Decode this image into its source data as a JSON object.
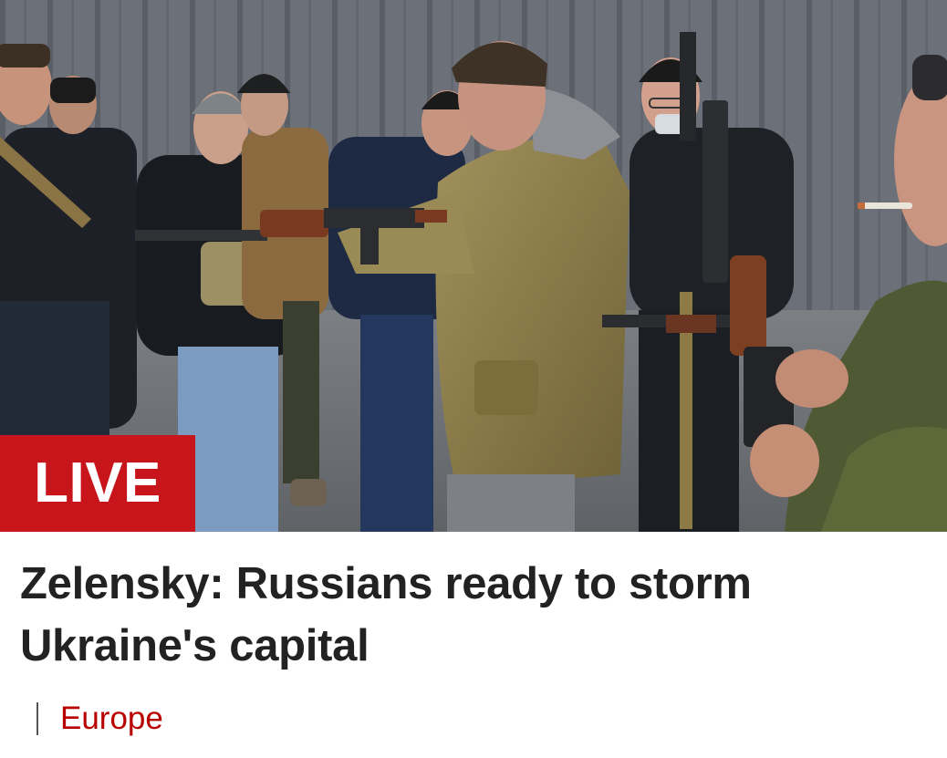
{
  "article": {
    "badge": "LIVE",
    "title": "Zelensky: Russians ready to storm Ukraine's capital",
    "section": "Europe"
  },
  "colors": {
    "live_badge": "#c8151b",
    "headline_text": "#222222",
    "section_link": "#b80000",
    "divider": "#555555"
  }
}
